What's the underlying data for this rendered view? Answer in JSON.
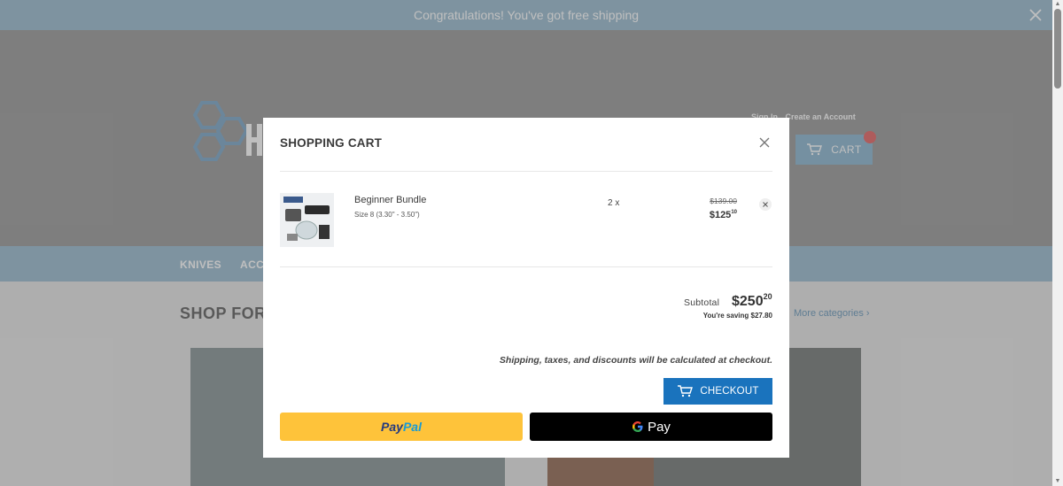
{
  "announcement": {
    "text": "Congratulations! You've got free shipping"
  },
  "header": {
    "account_links": [
      "Sign In",
      "Create an Account"
    ],
    "cart_label": "CART"
  },
  "nav": {
    "items": [
      "KNIVES",
      "ACCE"
    ]
  },
  "main": {
    "section_title": "SHOP FOR",
    "more_categories": "More categories ›"
  },
  "cart_modal": {
    "title": "SHOPPING CART",
    "item": {
      "name": "Beginner Bundle",
      "variant": "Size 8 (3.30\" - 3.50\")",
      "quantity": "2 x",
      "original_price": "$139.00",
      "price_main": "$125",
      "price_cents": "10"
    },
    "subtotal_label": "Subtotal",
    "subtotal_main": "$250",
    "subtotal_cents": "20",
    "saving": "You're saving $27.80",
    "shipping_note": "Shipping, taxes, and discounts will be calculated at checkout.",
    "checkout_label": "CHECKOUT",
    "paypal": {
      "part1": "Pay",
      "part2": "Pal"
    },
    "gpay_label": "Pay"
  },
  "colors": {
    "accent": "#1a73bd",
    "paypal_yellow": "#fec33a",
    "announcement_bar": "#a8c5d6"
  },
  "icons": [
    "close-icon",
    "cart-icon",
    "remove-item-icon",
    "google-g-icon"
  ]
}
